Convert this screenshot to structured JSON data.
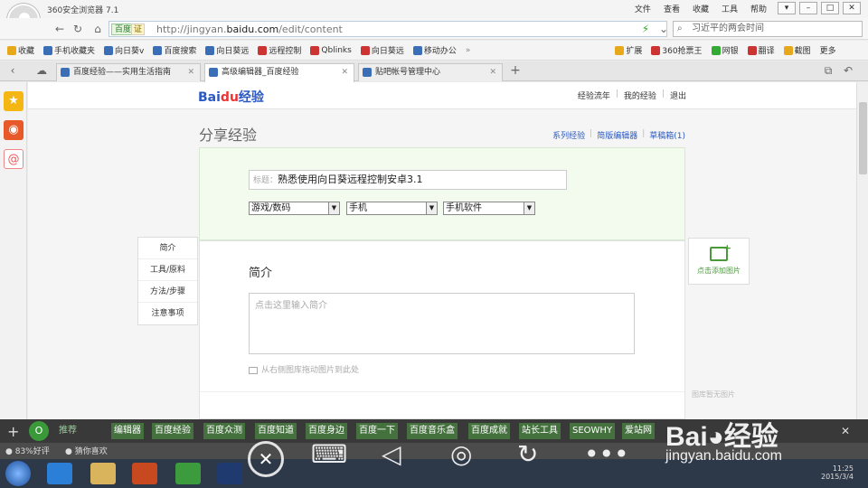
{
  "browser": {
    "app_title": "360安全浏览器 7.1",
    "menus": [
      "文件",
      "查看",
      "收藏",
      "工具",
      "帮助"
    ],
    "address": {
      "engine_badge": "百度",
      "cert_badge": "证",
      "url_prefix": "http://jingyan.",
      "url_domain": "baidu.com",
      "url_suffix": "/edit/content"
    },
    "search_placeholder": "习近平的两会时间",
    "bookmarks": [
      "收藏",
      "手机收藏夹",
      "向日葵v",
      "百度搜索",
      "向日葵远",
      "远程控制",
      "Qblinks",
      "向日葵远",
      "移动办公",
      "扩展",
      "360抢票王",
      "网银",
      "翻译",
      "截图",
      "更多"
    ],
    "tabs": [
      {
        "label": "百度经验——实用生活指南"
      },
      {
        "label": "高级编辑器_百度经验"
      },
      {
        "label": "贴吧帐号管理中心"
      }
    ]
  },
  "page": {
    "logo_text_1": "Bai",
    "logo_text_2": "du",
    "logo_text_3": "经验",
    "top_links": [
      "经验流年",
      "我的经验",
      "退出"
    ],
    "heading": "分享经验",
    "right_links": [
      "系列经验",
      "简版编辑器",
      "草稿箱(1)"
    ],
    "title_label": "标题：",
    "title_value": "熟悉使用向日葵远程控制安卓3.1",
    "selects": [
      "游戏/数码",
      "手机",
      "手机软件"
    ],
    "left_nav": [
      "简介",
      "工具/原料",
      "方法/步骤",
      "注意事项"
    ],
    "section_title": "简介",
    "intro_placeholder": "点击这里输入简介",
    "image_note": "从右侧图库拖动图片到此处",
    "add_image": "点击添加图片",
    "empty_library": "图库暂无图片"
  },
  "overlay": {
    "buttons": [
      "推荐",
      "编辑器",
      "百度经验",
      "百度众测",
      "百度知道",
      "百度身边",
      "百度一下",
      "百度音乐盒",
      "百度成就",
      "站长工具",
      "SEOWHY",
      "爱站网"
    ],
    "status_left": "83%好评",
    "status_right": "猜你喜欢",
    "watermark_1": "Bai",
    "watermark_2": "经验",
    "watermark_url": "jingyan.baidu.com",
    "time": "11:25",
    "date": "2015/3/4"
  }
}
